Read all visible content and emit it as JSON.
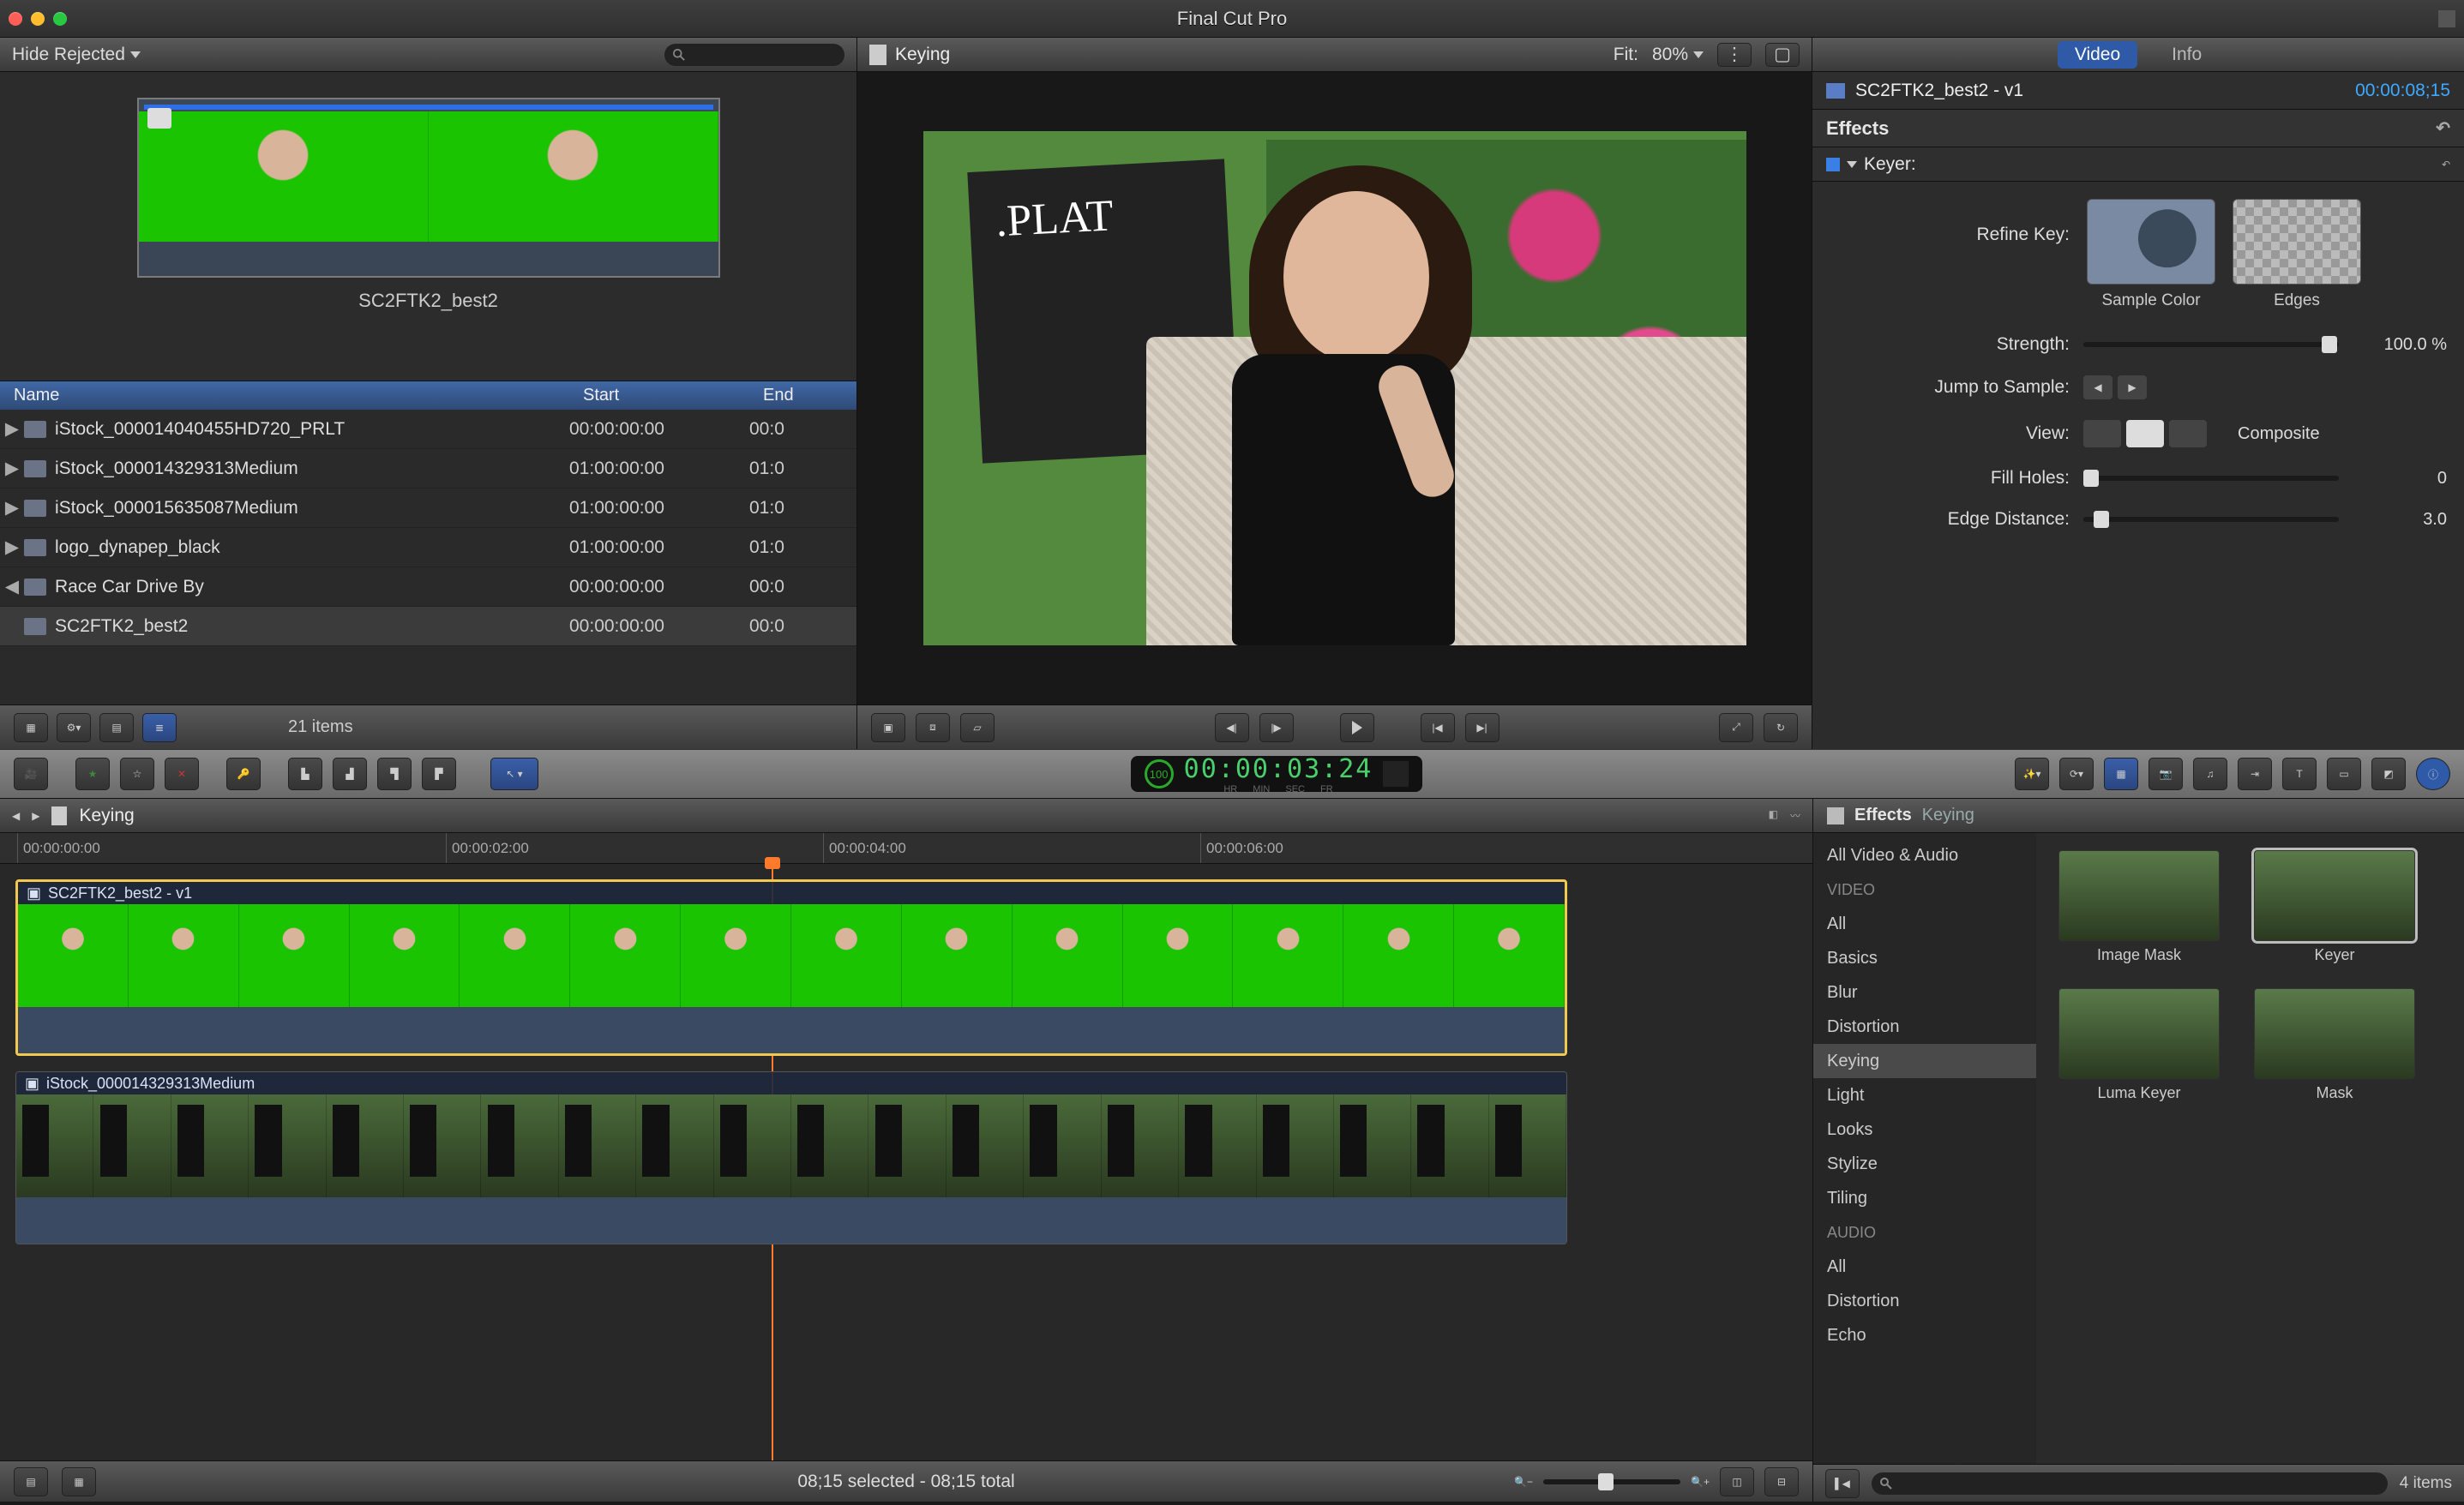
{
  "window": {
    "title": "Final Cut Pro"
  },
  "browser": {
    "filter_label": "Hide Rejected",
    "search_placeholder": "",
    "thumb_label": "SC2FTK2_best2",
    "columns": {
      "name": "Name",
      "start": "Start",
      "end": "End"
    },
    "rows": [
      {
        "name": "iStock_000014040455HD720_PRLT",
        "start": "00:00:00:00",
        "end": "00:0",
        "disclosure": "▶"
      },
      {
        "name": "iStock_000014329313Medium",
        "start": "01:00:00:00",
        "end": "01:0",
        "disclosure": "▶"
      },
      {
        "name": "iStock_000015635087Medium",
        "start": "01:00:00:00",
        "end": "01:0",
        "disclosure": "▶"
      },
      {
        "name": "logo_dynapep_black",
        "start": "01:00:00:00",
        "end": "01:0",
        "disclosure": "▶"
      },
      {
        "name": "Race Car Drive By",
        "start": "00:00:00:00",
        "end": "00:0",
        "disclosure": "◀"
      },
      {
        "name": "SC2FTK2_best2",
        "start": "00:00:00:00",
        "end": "00:0",
        "disclosure": "",
        "selected": true
      }
    ],
    "items_count": "21 items"
  },
  "viewer": {
    "title": "Keying",
    "fit_label": "Fit:",
    "zoom_label": "80%",
    "chalkboard_text": ".PLAT"
  },
  "inspector": {
    "tabs": {
      "video": "Video",
      "info": "Info"
    },
    "clip_name": "SC2FTK2_best2 - v1",
    "clip_tc": "00:00:08;15",
    "effects_label": "Effects",
    "effect_name": "Keyer:",
    "refine_label": "Refine Key:",
    "refine_sample": "Sample Color",
    "refine_edges": "Edges",
    "params": {
      "strength": {
        "label": "Strength:",
        "value": "100.0  %"
      },
      "jump": {
        "label": "Jump to Sample:"
      },
      "view": {
        "label": "View:",
        "value": "Composite"
      },
      "fill": {
        "label": "Fill Holes:",
        "value": "0"
      },
      "edge": {
        "label": "Edge Distance:",
        "value": "3.0"
      }
    }
  },
  "glyphstrip": {
    "ring_value": "100",
    "timecode": "00:00:03:24",
    "tc_labels": [
      "HR",
      "MIN",
      "SEC",
      "FR"
    ]
  },
  "timeline": {
    "title": "Keying",
    "ruler": [
      "00:00:00:00",
      "00:00:02:00",
      "00:00:04:00",
      "00:00:06:00"
    ],
    "clip1_name": "SC2FTK2_best2 - v1",
    "clip2_name": "iStock_000014329313Medium",
    "footer_summary": "08;15 selected - 08;15 total"
  },
  "fx": {
    "breadcrumb_root": "Effects",
    "breadcrumb_leaf": "Keying",
    "categories_head1": "All Video & Audio",
    "categories_head_video": "VIDEO",
    "categories_head_audio": "AUDIO",
    "video_cats": [
      "All",
      "Basics",
      "Blur",
      "Distortion",
      "Keying",
      "Light",
      "Looks",
      "Stylize",
      "Tiling"
    ],
    "audio_cats": [
      "All",
      "Distortion",
      "Echo"
    ],
    "items": [
      {
        "name": "Image Mask"
      },
      {
        "name": "Keyer",
        "selected": true
      },
      {
        "name": "Luma Keyer"
      },
      {
        "name": "Mask"
      }
    ],
    "count": "4 items"
  }
}
